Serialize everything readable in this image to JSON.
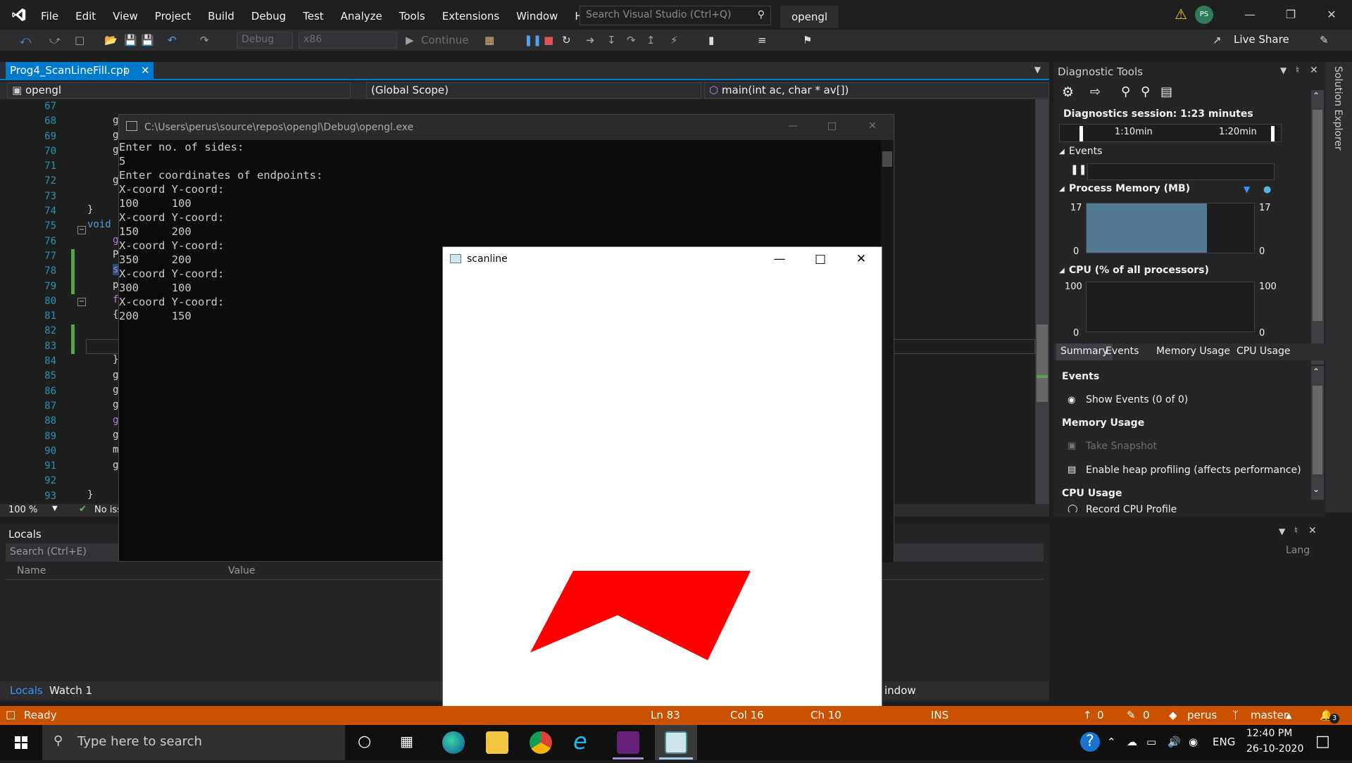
{
  "titlebar": {
    "menu": [
      "File",
      "Edit",
      "View",
      "Project",
      "Build",
      "Debug",
      "Test",
      "Analyze",
      "Tools",
      "Extensions",
      "Window",
      "Help"
    ],
    "search_placeholder": "Search Visual Studio (Ctrl+Q)",
    "project_name": "opengl",
    "avatar_initials": "PS"
  },
  "toolbar": {
    "config": "Debug",
    "platform": "x86",
    "continue_label": "Continue",
    "live_share": "Live Share"
  },
  "editor": {
    "tab_label": "Prog4_ScanLineFill.cpp",
    "nav_project": "opengl",
    "nav_scope": "(Global Scope)",
    "nav_function": "main(int ac, char * av[])",
    "line_numbers": [
      "67",
      "68",
      "69",
      "70",
      "71",
      "72",
      "73",
      "74",
      "75",
      "76",
      "77",
      "78",
      "79",
      "80",
      "81",
      "82",
      "83",
      "84",
      "85",
      "86",
      "87",
      "88",
      "89",
      "90",
      "91",
      "92",
      "93"
    ],
    "code_fragments": {
      "l68": "g",
      "l69": "g",
      "l70": "g",
      "l72": "g",
      "l74": "}",
      "l75": "void",
      "l76": "g",
      "l77": "P",
      "l78": "s",
      "l79": "p",
      "l80": "f",
      "l81": "{",
      "l84": "}",
      "l85": "g",
      "l86": "g",
      "l87": "g",
      "l88": "g",
      "l89": "g",
      "l90": "m",
      "l91": "g",
      "l93": "}"
    },
    "zoom": "100 %",
    "issues": "No iss"
  },
  "console": {
    "title": "C:\\Users\\perus\\source\\repos\\opengl\\Debug\\opengl.exe",
    "output": "Enter no. of sides:\n5\nEnter coordinates of endpoints:\nX-coord Y-coord:\n100     100\nX-coord Y-coord:\n150     200\nX-coord Y-coord:\n350     200\nX-coord Y-coord:\n300     100\nX-coord Y-coord:\n200     150"
  },
  "scanline": {
    "title": "scanline",
    "fill_color": "#ff0000"
  },
  "locals": {
    "header": "Locals",
    "search_placeholder": "Search (Ctrl+E)",
    "col_name": "Name",
    "col_value": "Value",
    "tab_locals": "Locals",
    "tab_watch": "Watch 1",
    "lang_label": "Lang",
    "window_label": "indow"
  },
  "diagnostics": {
    "title": "Diagnostic Tools",
    "session": "Diagnostics session: 1:23 minutes",
    "tick1": "1:10min",
    "tick2": "1:20min",
    "events_label": "Events",
    "memory_label": "Process Memory (MB)",
    "mem_max": "17",
    "mem_min": "0",
    "cpu_label": "CPU (% of all processors)",
    "cpu_max": "100",
    "cpu_min": "0",
    "tabs": [
      "Summary",
      "Events",
      "Memory Usage",
      "CPU Usage"
    ],
    "sec_events": "Events",
    "show_events": "Show Events (0 of 0)",
    "sec_memory": "Memory Usage",
    "take_snapshot": "Take Snapshot",
    "heap_profiling": "Enable heap profiling (affects performance)",
    "sec_cpu": "CPU Usage",
    "record_cpu": "Record CPU Profile",
    "memory_fill_fraction": 0.72
  },
  "solution_explorer": "Solution Explorer",
  "statusbar": {
    "ready": "Ready",
    "ln": "Ln 83",
    "col": "Col 16",
    "ch": "Ch 10",
    "ins": "INS",
    "up_count": "0",
    "pencil_count": "0",
    "user": "perus",
    "branch": "master",
    "notifications": "3"
  },
  "taskbar": {
    "search_placeholder": "Type here to search",
    "lang": "ENG",
    "time": "12:40 PM",
    "date": "26-10-2020"
  },
  "colors": {
    "accent": "#007acc",
    "statusbar": "#ca5100",
    "memory_fill": "#5b8aa6"
  }
}
